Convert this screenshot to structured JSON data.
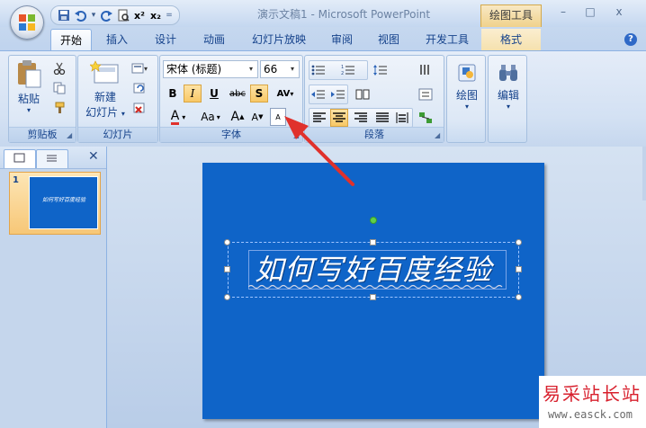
{
  "window": {
    "title": "演示文稿1 - Microsoft PowerPoint",
    "context_tab_header": "绘图工具",
    "minimize": "–",
    "maximize": "□",
    "close": "x"
  },
  "qat": {
    "overflow": "="
  },
  "tabs": [
    "开始",
    "插入",
    "设计",
    "动画",
    "幻灯片放映",
    "审阅",
    "视图",
    "开发工具",
    "格式"
  ],
  "help": "?",
  "ribbon": {
    "clipboard": {
      "label": "剪贴板",
      "paste": "粘贴"
    },
    "slides": {
      "label": "幻灯片",
      "new_slide_line1": "新建",
      "new_slide_line2": "幻灯片"
    },
    "font": {
      "label": "字体",
      "font_name": "宋体 (标题)",
      "font_size": "66",
      "bold": "B",
      "italic": "I",
      "underline": "U",
      "strike": "abc",
      "shadow": "S",
      "spacing": "AV",
      "color": "A",
      "case": "Aa",
      "grow": "A",
      "shrink": "A",
      "clear": "A"
    },
    "paragraph": {
      "label": "段落"
    },
    "drawing": {
      "label": "绘图"
    },
    "editing": {
      "label": "编辑"
    }
  },
  "left_pane": {
    "slide_number": "1",
    "thumb_text": "如何写好百度经验"
  },
  "slide": {
    "title": "如何写好百度经验"
  },
  "watermark": {
    "cn": "易采站长站",
    "url": "www.easck.com"
  },
  "colors": {
    "slide_bg": "#0f64c8",
    "arrow": "#e0312c",
    "highlight": "#f8c866"
  }
}
